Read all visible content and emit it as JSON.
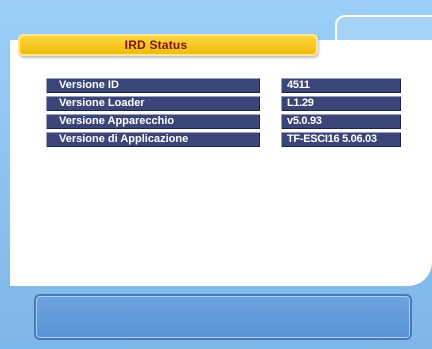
{
  "header": {
    "title": "IRD Status"
  },
  "info_rows": [
    {
      "label": "Versione ID",
      "value": "4511"
    },
    {
      "label": "Versione Loader",
      "value": "L1.29"
    },
    {
      "label": "Versione Apparecchio",
      "value": "v5.0.93"
    },
    {
      "label": "Versione di Applicazione",
      "value": "TF-ESCI16 5.06.03"
    }
  ],
  "message_box": {
    "text": ""
  },
  "colors": {
    "background": "#8fc4f2",
    "panel": "#ffffff",
    "title_bar": "#f7c51c",
    "title_text": "#7a1414",
    "row_fill": "#3b4577",
    "row_text": "#ffffff",
    "message_box": "#5993d6"
  }
}
